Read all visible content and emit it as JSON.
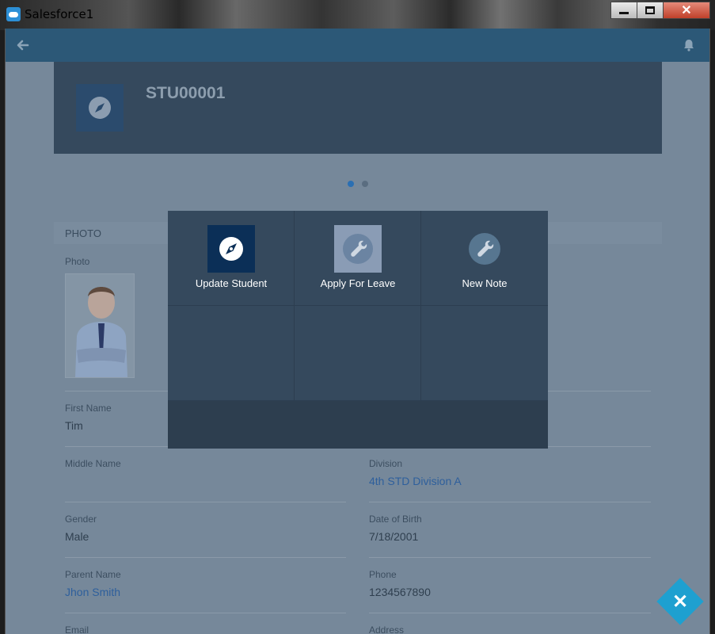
{
  "window": {
    "title": "Salesforce1",
    "close_symbol": "✕"
  },
  "header": {
    "back_icon": "arrow-left-icon",
    "bell_icon": "bell-icon"
  },
  "record": {
    "title": "STU00001",
    "icon": "compass-icon"
  },
  "carousel": {
    "pages": 2,
    "active": 0
  },
  "section": {
    "title": "PHOTO"
  },
  "fields": {
    "photo_label": "Photo",
    "first_name_label": "First Name",
    "first_name": "Tim",
    "middle_name_label": "Middle Name",
    "middle_name": "",
    "division_label": "Division",
    "division": "4th STD Division A",
    "gender_label": "Gender",
    "gender": "Male",
    "dob_label": "Date of Birth",
    "dob": "7/18/2001",
    "parent_label": "Parent Name",
    "parent": "Jhon Smith",
    "phone_label": "Phone",
    "phone": "1234567890",
    "email_label": "Email",
    "address_label": "Address"
  },
  "actions": [
    {
      "label": "Update Student",
      "icon": "compass-icon",
      "bg": "#0b2f57"
    },
    {
      "label": "Apply For Leave",
      "icon": "wrench-icon",
      "bg": "#8a9cb5"
    },
    {
      "label": "New Note",
      "icon": "wrench-icon",
      "bg": "#577690"
    }
  ],
  "fab": {
    "symbol": "✕",
    "color": "#1ea0d0"
  }
}
